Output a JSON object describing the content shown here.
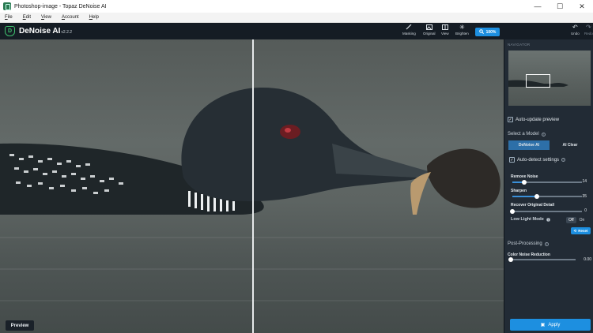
{
  "window": {
    "title": "Photoshop-image - Topaz DeNoise AI",
    "minimize": "—",
    "maximize": "☐",
    "close": "✕"
  },
  "menu": [
    "File",
    "Edit",
    "View",
    "Account",
    "Help"
  ],
  "brand": {
    "name": "DeNoise AI",
    "version": "v2.2.2"
  },
  "toolbar": {
    "masking": "Masking",
    "original": "Original",
    "view": "View",
    "brighten": "Brighten",
    "zoom": "100%",
    "undo": "Undo",
    "redo": "Redo"
  },
  "canvas": {
    "preview_label": "Preview"
  },
  "panel": {
    "navigator_title": "NAVIGATOR",
    "auto_update_label": "Auto-update preview",
    "select_model_label": "Select a Model",
    "models": [
      {
        "label": "DeNoise AI",
        "active": true
      },
      {
        "label": "AI Clear",
        "active": false
      }
    ],
    "auto_detect_label": "Auto-detect settings",
    "sliders": [
      {
        "label": "Remove Noise",
        "value": "14",
        "fraction": 0.17
      },
      {
        "label": "Sharpen",
        "value": "35",
        "fraction": 0.35
      },
      {
        "label": "Recover Original Detail",
        "value": "0",
        "fraction": 0.0
      }
    ],
    "low_light_label": "Low Light Mode",
    "low_light_off": "Off",
    "low_light_on": "On",
    "reset_label": "Reset",
    "post_processing_label": "Post-Processing",
    "color_noise_label": "Color Noise Reduction",
    "color_noise_value": "0.00",
    "color_noise_fraction": 0.0,
    "apply_label": "Apply"
  },
  "colors": {
    "accent": "#1d8fe0",
    "active_tab": "#2d6fa8",
    "panel_bg": "#222b35",
    "toolbar_bg": "#151c24"
  }
}
